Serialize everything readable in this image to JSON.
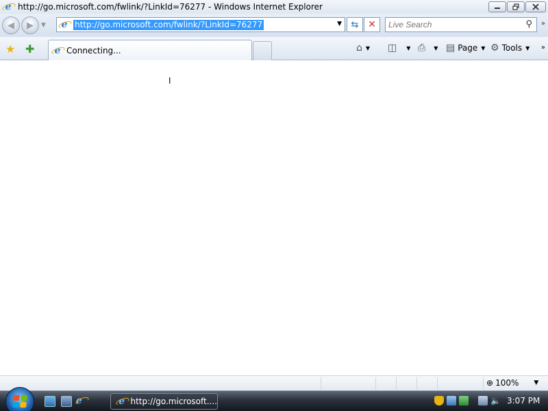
{
  "window": {
    "title": "http://go.microsoft.com/fwlink/?LinkId=76277 - Windows Internet Explorer"
  },
  "navbar": {
    "address": "http://go.microsoft.com/fwlink/?LinkId=76277",
    "search_placeholder": "Live Search"
  },
  "tab": {
    "label": "Connecting..."
  },
  "commands": {
    "page_label": "Page",
    "tools_label": "Tools"
  },
  "status": {
    "zoom": "100%"
  },
  "taskbar": {
    "task_label": "http://go.microsoft....",
    "clock": "3:07 PM"
  },
  "icons": {
    "browser": "ie-icon",
    "favorites": "star-icon",
    "add_favorites": "add-favorite-icon",
    "home": "home-icon",
    "feeds": "rss-icon",
    "print": "printer-icon",
    "page": "page-icon",
    "tools": "gear-icon"
  },
  "colors": {
    "selection": "#3399ff",
    "chrome": "#dde6f1",
    "taskbar": "#1c2129"
  }
}
